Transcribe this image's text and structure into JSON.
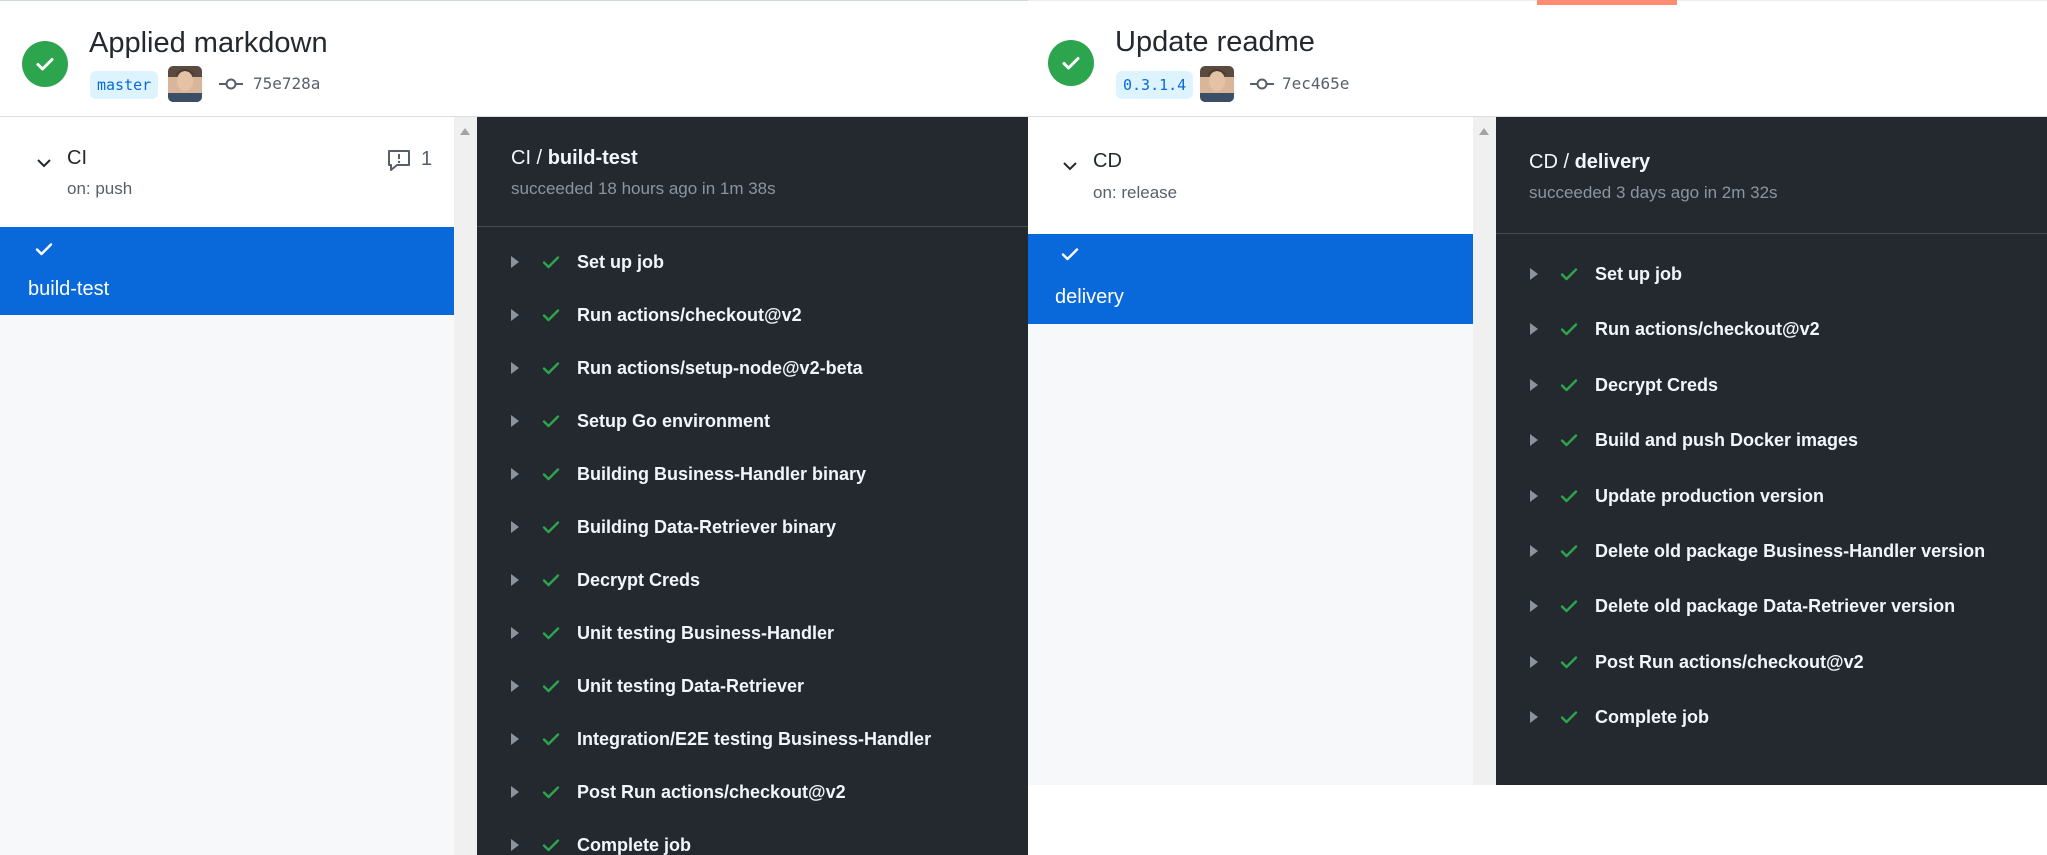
{
  "colors": {
    "success": "#2da44e",
    "accent_tab": "#fd8c73",
    "selected_job": "#0969da",
    "log_bg": "#24292f"
  },
  "left": {
    "commit_title": "Applied markdown",
    "branch": "master",
    "sha": "75e728a",
    "workflow": {
      "name": "CI",
      "trigger": "on: push",
      "comment_count": "1"
    },
    "job": {
      "name": "build-test"
    },
    "log": {
      "prefix": "CI /",
      "job": "build-test",
      "status": "succeeded 18 hours ago in 1m 38s",
      "steps": [
        "Set up job",
        "Run actions/checkout@v2",
        "Run actions/setup-node@v2-beta",
        "Setup Go environment",
        "Building Business-Handler binary",
        "Building Data-Retriever binary",
        "Decrypt Creds",
        "Unit testing Business-Handler",
        "Unit testing Data-Retriever",
        "Integration/E2E testing Business-Handler",
        "Post Run actions/checkout@v2",
        "Complete job"
      ]
    }
  },
  "right": {
    "commit_title": "Update readme",
    "branch": "0.3.1.4",
    "sha": "7ec465e",
    "workflow": {
      "name": "CD",
      "trigger": "on: release"
    },
    "job": {
      "name": "delivery"
    },
    "log": {
      "prefix": "CD /",
      "job": "delivery",
      "status": "succeeded 3 days ago in 2m 32s",
      "steps": [
        "Set up job",
        "Run actions/checkout@v2",
        "Decrypt Creds",
        "Build and push Docker images",
        "Update production version",
        "Delete old package Business-Handler version",
        "Delete old package Data-Retriever version",
        "Post Run actions/checkout@v2",
        "Complete job"
      ]
    }
  }
}
